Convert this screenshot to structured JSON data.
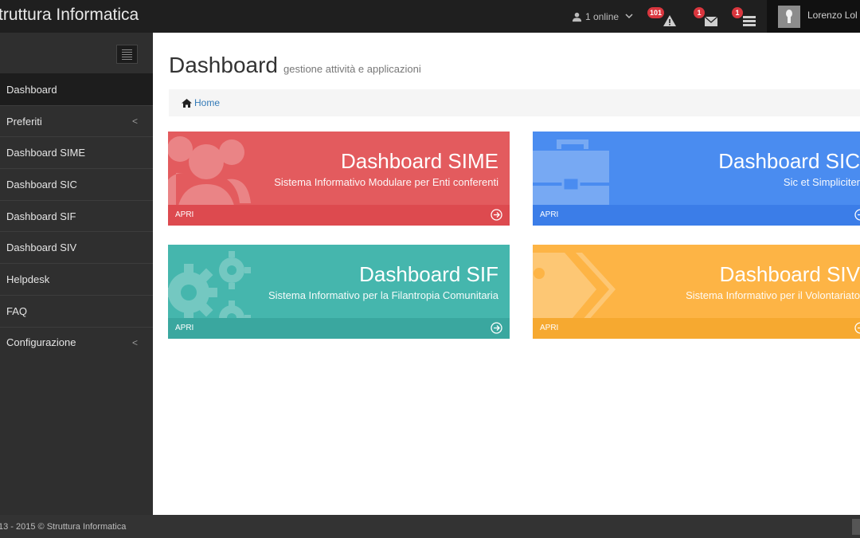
{
  "header": {
    "brand": "truttura Informatica",
    "online_text": "1 online",
    "notifications": [
      {
        "name": "alerts",
        "count": "101",
        "icon": "warning-icon"
      },
      {
        "name": "messages",
        "count": "1",
        "icon": "envelope-icon"
      },
      {
        "name": "tasks",
        "count": "1",
        "icon": "tasks-icon"
      }
    ],
    "username": "Lorenzo Lol"
  },
  "sidebar": {
    "items": [
      {
        "label": "Dashboard",
        "active": true,
        "has_submenu": false
      },
      {
        "label": "Preferiti",
        "active": false,
        "has_submenu": true
      },
      {
        "label": "Dashboard SIME",
        "active": false,
        "has_submenu": false
      },
      {
        "label": "Dashboard SIC",
        "active": false,
        "has_submenu": false
      },
      {
        "label": "Dashboard SIF",
        "active": false,
        "has_submenu": false
      },
      {
        "label": "Dashboard SIV",
        "active": false,
        "has_submenu": false
      },
      {
        "label": "Helpdesk",
        "active": false,
        "has_submenu": false
      },
      {
        "label": "FAQ",
        "active": false,
        "has_submenu": false
      },
      {
        "label": "Configurazione",
        "active": false,
        "has_submenu": true
      }
    ],
    "caret": "<"
  },
  "page": {
    "title": "Dashboard",
    "subtitle": "gestione attività e applicazioni",
    "breadcrumb_home": "Home"
  },
  "tiles": [
    {
      "title": "Dashboard SIME",
      "description": "Sistema Informativo Modulare per Enti conferenti",
      "footer": "APRI",
      "color": "#e35b5e",
      "icon": "users-icon"
    },
    {
      "title": "Dashboard SIC",
      "description": "Sic et Simpliciter",
      "footer": "APRI",
      "color": "#4a8cf0",
      "icon": "briefcase-icon"
    },
    {
      "title": "Dashboard SIF",
      "description": "Sistema Informativo per la Filantropia Comunitaria",
      "footer": "APRI",
      "color": "#45b6ad",
      "icon": "gears-icon"
    },
    {
      "title": "Dashboard SIV",
      "description": "Sistema Informativo per il Volontariato",
      "footer": "APRI",
      "color": "#fdb445",
      "icon": "tags-icon"
    }
  ],
  "footer": {
    "copyright": "13 - 2015 © Struttura Informatica"
  }
}
